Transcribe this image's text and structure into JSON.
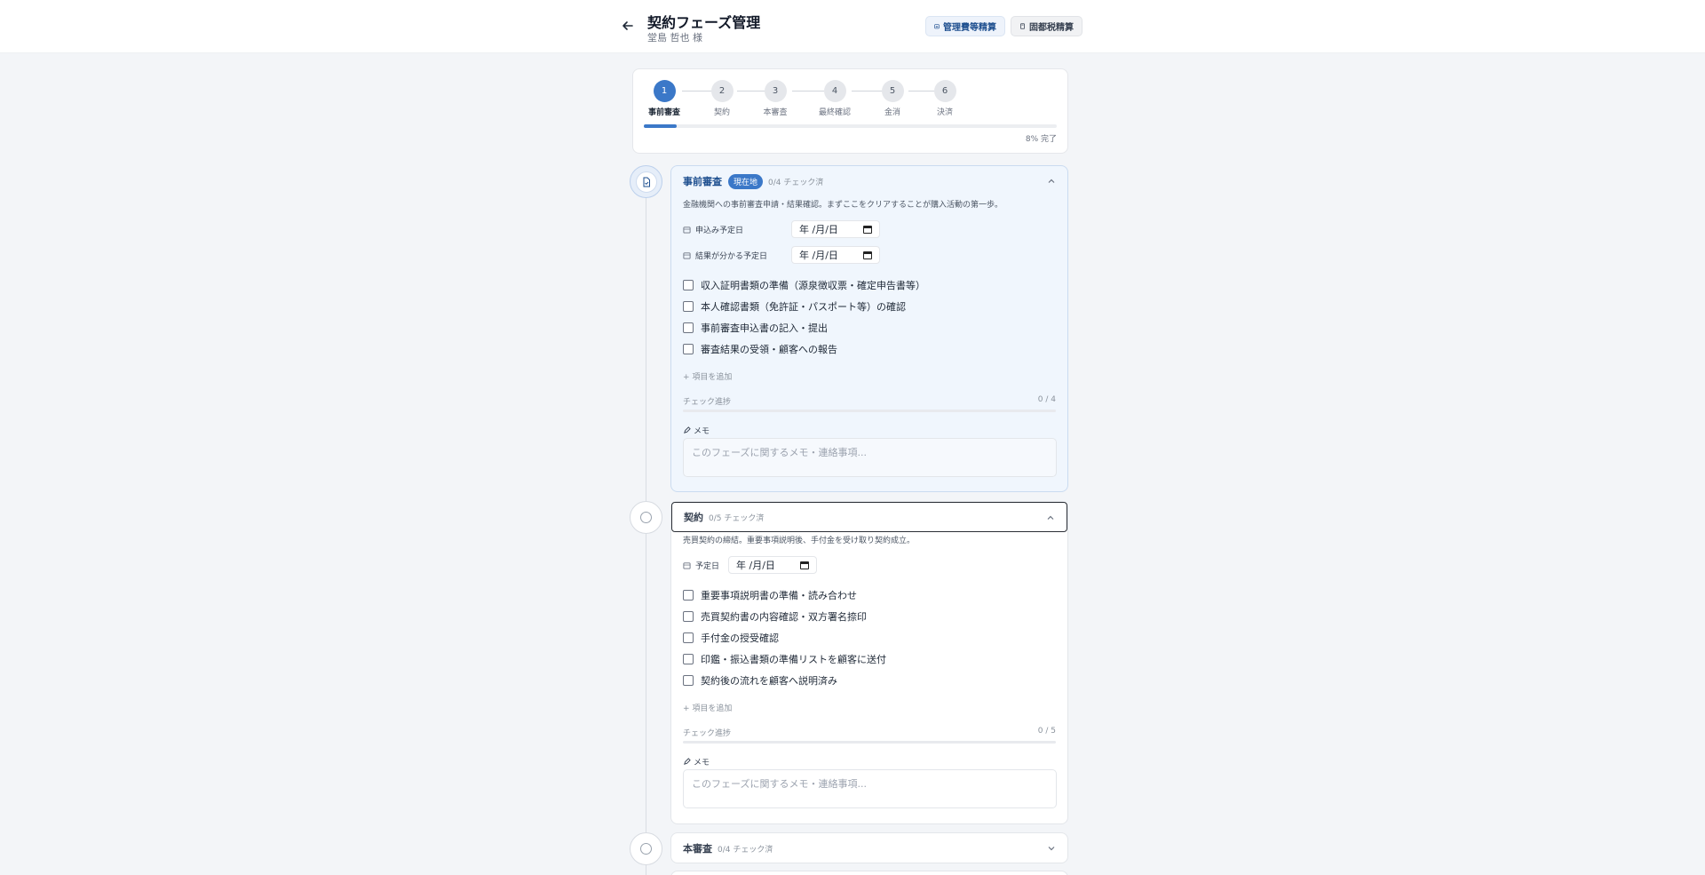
{
  "header": {
    "title": "契約フェーズ管理",
    "subtitle": "堂島 哲也 様",
    "btn_management": "管理費等精算",
    "btn_tax": "固都税精算"
  },
  "stepper": {
    "steps": [
      {
        "num": "1",
        "label": "事前審査"
      },
      {
        "num": "2",
        "label": "契約"
      },
      {
        "num": "3",
        "label": "本審査"
      },
      {
        "num": "4",
        "label": "最終確認"
      },
      {
        "num": "5",
        "label": "金消"
      },
      {
        "num": "6",
        "label": "決済"
      }
    ],
    "progress_percent": 8,
    "progress_text": "8% 完了"
  },
  "phases": [
    {
      "name": "事前審査",
      "badge": "現在地",
      "count": "0/4 チェック済",
      "description": "金融機関への事前審査申請・結果確認。まずここをクリアすることが購入活動の第一歩。",
      "dates": [
        {
          "label": "申込み予定日",
          "value": "年 /月/日"
        },
        {
          "label": "結果が分かる予定日",
          "value": "年 /月/日"
        }
      ],
      "checks": [
        "収入証明書類の準備（源泉徴収票・確定申告書等）",
        "本人確認書類（免許証・パスポート等）の確認",
        "事前審査申込書の記入・提出",
        "審査結果の受領・顧客への報告"
      ],
      "add_item": "+ 項目を追加",
      "progress_label": "チェック進捗",
      "progress_value": "0 / 4",
      "memo_label": "メモ",
      "memo_placeholder": "このフェーズに関するメモ・連絡事項..."
    },
    {
      "name": "契約",
      "count": "0/5 チェック済",
      "description": "売買契約の締結。重要事項説明後、手付金を受け取り契約成立。",
      "dates": [
        {
          "label": "予定日",
          "value": "年 /月/日"
        }
      ],
      "checks": [
        "重要事項説明書の準備・読み合わせ",
        "売買契約書の内容確認・双方署名捺印",
        "手付金の授受確認",
        "印鑑・振込書類の準備リストを顧客に送付",
        "契約後の流れを顧客へ説明済み"
      ],
      "add_item": "+ 項目を追加",
      "progress_label": "チェック進捗",
      "progress_value": "0 / 5",
      "memo_label": "メモ",
      "memo_placeholder": "このフェーズに関するメモ・連絡事項..."
    },
    {
      "name": "本審査",
      "count": "0/4 チェック済"
    }
  ],
  "colors": {
    "accent": "#3b78c8",
    "active_card_bg": "#f0f6fd"
  }
}
